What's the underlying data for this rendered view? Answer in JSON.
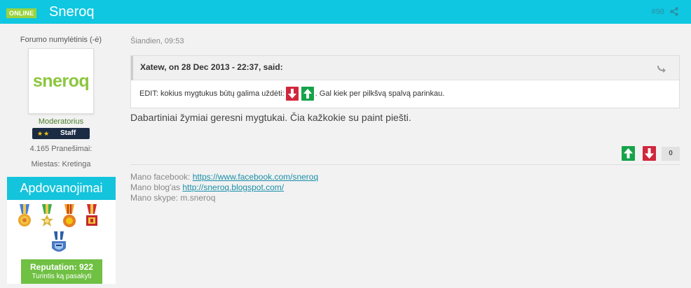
{
  "header": {
    "online_badge": "ONLINE",
    "author_name": "Sneroq",
    "post_number": "#98",
    "bg_color": "#0fc7e0"
  },
  "author": {
    "member_title": "Forumo numylėtinis (-ė)",
    "avatar_text": "sneroq",
    "group_name": "Moderatorius",
    "staff_label": "Staff",
    "staff_stars": "★★",
    "post_count": "4.165 Pranešimai:",
    "location": "Miestas: Kretinga",
    "awards_title": "Apdovanojimai",
    "reputation_value": "Reputation: 922",
    "reputation_text": "Turintis ką pasakyti"
  },
  "post": {
    "date": "Šiandien, 09:53",
    "quote": {
      "citation": "Xatew, on 28 Dec 2013 - 22:37, said:",
      "text_before": "EDIT: kokius mygtukus būtų galima uždėti:",
      "text_after": ". Gal kiek per pilkšvą spalvą parinkau."
    },
    "body": "Dabartiniai žymiai geresni mygtukai. Čia kažkokie su paint piešti.",
    "vote_count": "0"
  },
  "signature": {
    "facebook_label": "Mano facebook:",
    "facebook_url": "https://www.facebook.com/sneroq",
    "blog_label": "Mano blog'as",
    "blog_url": "http://sneroq.blogspot.com/",
    "skype_text": "Mano skype: m.sneroq"
  },
  "colors": {
    "accent": "#0fc7e0",
    "vote_up": "#16a34a",
    "vote_down": "#d0273c",
    "reputation": "#6fc043",
    "staff": "#1c2b44"
  }
}
